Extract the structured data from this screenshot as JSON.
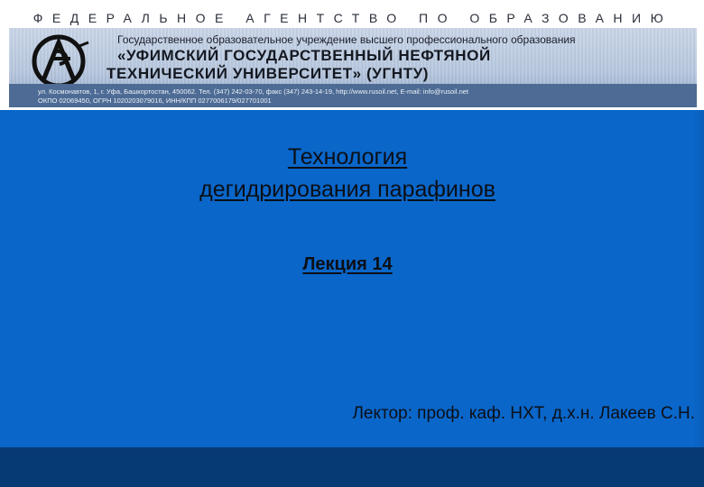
{
  "letterhead": {
    "agency": "ФЕДЕРАЛЬНОЕ АГЕНТСТВО ПО ОБРАЗОВАНИЮ",
    "subtitle": "Государственное образовательное учреждение высшего профессионального образования",
    "name_line1": "«УФИМСКИЙ ГОСУДАРСТВЕННЫЙ НЕФТЯНОЙ",
    "name_line2": "ТЕХНИЧЕСКИЙ УНИВЕРСИТЕТ» (УГНТУ)",
    "contact_line1": "ул. Космонавтов, 1, г. Уфа, Башкортостан, 450062. Тел. (347) 242-03-70, факс (347) 243-14-19, http://www.rusoil.net, E-mail: info@rusoil.net",
    "contact_line2": "ОКПО 02069450, ОГРН 1020203079016, ИНН/КПП 0277006179/027701001",
    "logo_icon": "university-emblem-icon"
  },
  "slide": {
    "title_line1": "Технология",
    "title_line2": "дегидрирования парафинов",
    "lecture": "Лекция 14",
    "lecturer": "Лектор: проф. каф. НХТ, д.х.н.  Лакеев С.Н."
  },
  "colors": {
    "background": "#0a66c9",
    "footer": "#063a74",
    "banner": "#b7c7de",
    "text": "#0b0f16"
  }
}
